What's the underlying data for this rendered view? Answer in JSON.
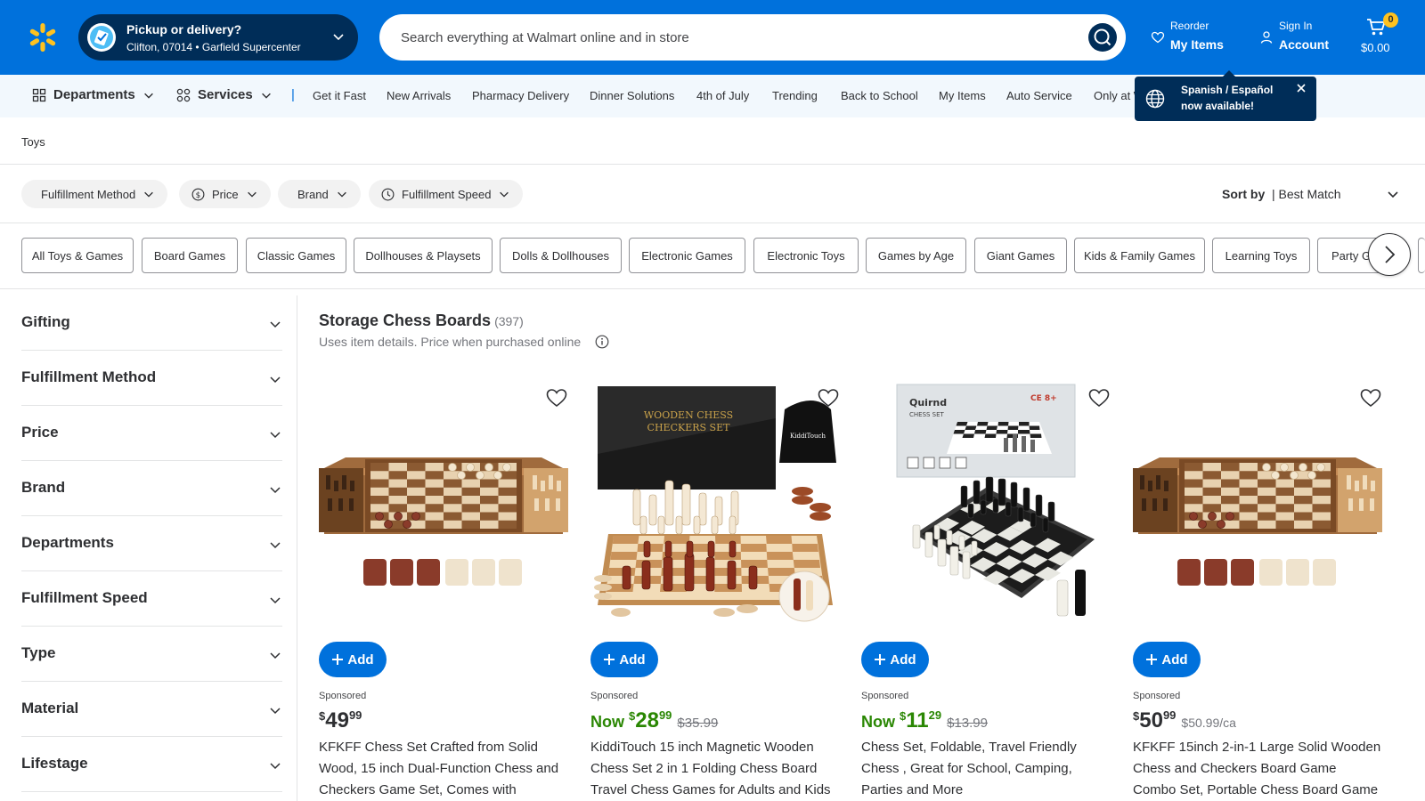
{
  "header": {
    "pickup_title": "Pickup or delivery?",
    "pickup_location": "Clifton, 07014 • Garfield Supercenter",
    "search_placeholder": "Search everything at Walmart online and in store",
    "reorder_small": "Reorder",
    "reorder_big": "My Items",
    "signin_small": "Sign In",
    "signin_big": "Account",
    "cart_count": "0",
    "cart_total": "$0.00"
  },
  "nav": {
    "departments": "Departments",
    "services": "Services",
    "separator": "|",
    "links": [
      "Get it Fast",
      "New Arrivals",
      "Pharmacy Delivery",
      "Dinner Solutions",
      "4th of July",
      "Trending",
      "Back to School",
      "My Items",
      "Auto Service",
      "Only at W"
    ]
  },
  "toast": {
    "text": "Spanish / Español now available!"
  },
  "breadcrumb": "Toys",
  "filters": [
    "Fulfillment Method",
    "Price",
    "Brand",
    "Fulfillment Speed"
  ],
  "sort": {
    "label": "Sort by",
    "value": "| Best Match"
  },
  "chips": [
    "All Toys & Games",
    "Board Games",
    "Classic Games",
    "Dollhouses & Playsets",
    "Dolls & Dollhouses",
    "Electronic Games",
    "Electronic Toys",
    "Games by Age",
    "Giant Games",
    "Kids & Family Games",
    "Learning Toys",
    "Party G"
  ],
  "facets": [
    "Gifting",
    "Fulfillment Method",
    "Price",
    "Brand",
    "Departments",
    "Fulfillment Speed",
    "Type",
    "Material",
    "Lifestage"
  ],
  "results": {
    "title": "Storage Chess Boards",
    "count": "(397)",
    "subtitle": "Uses item details. Price when purchased online"
  },
  "products": [
    {
      "add": "Add",
      "sponsored": "Sponsored",
      "now": "",
      "currency": "$",
      "dollars": "49",
      "cents": "99",
      "was": "",
      "unit": "",
      "title": "KFKFF Chess Set Crafted from Solid Wood, 15 inch Dual-Function Chess and Checkers Game Set, Comes with Storage..."
    },
    {
      "add": "Add",
      "sponsored": "Sponsored",
      "now": "Now ",
      "currency": "$",
      "dollars": "28",
      "cents": "99",
      "was": "$35.99",
      "unit": "",
      "title": "KiddiTouch 15 inch Magnetic Wooden Chess Set 2 in 1 Folding Chess Board Travel Chess Games for Adults and Kids"
    },
    {
      "add": "Add",
      "sponsored": "Sponsored",
      "now": "Now ",
      "currency": "$",
      "dollars": "11",
      "cents": "29",
      "was": "$13.99",
      "unit": "",
      "title": "Chess Set, Foldable, Travel Friendly Chess , Great for School, Camping, Parties and More"
    },
    {
      "add": "Add",
      "sponsored": "Sponsored",
      "now": "",
      "currency": "$",
      "dollars": "50",
      "cents": "99",
      "was": "",
      "unit": "$50.99/ca",
      "title": "KFKFF 15inch 2-in-1 Large Solid Wooden Chess and Checkers Board Game Combo Set, Portable Chess Board Game with..."
    }
  ],
  "product_images": {
    "box_text_1": "WOODEN CHESS",
    "box_text_2": "CHECKERS SET",
    "bag_text": "KiddiTouch",
    "box2_brand": "Quirnd",
    "box2_sub": "CHESS SET",
    "box2_marks": "CE 8+"
  },
  "colors": {
    "brand_blue": "#0071dc",
    "navy": "#002d58",
    "yellow": "#ffc220",
    "price_green": "#2a8703"
  }
}
